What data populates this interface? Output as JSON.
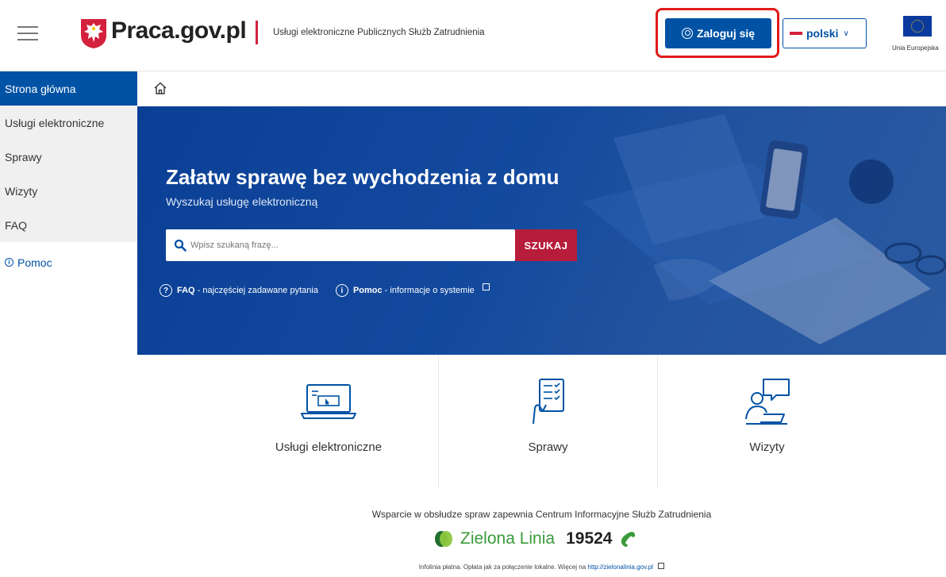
{
  "header": {
    "logo_text": "Praca.gov.pl",
    "tagline": "Usługi elektroniczne Publicznych Służb Zatrudnienia",
    "login_label": "Zaloguj się",
    "language_label": "polski",
    "eu_label": "Unia Europejska"
  },
  "sidebar": {
    "items": [
      {
        "label": "Strona główna",
        "active": true
      },
      {
        "label": "Usługi elektroniczne",
        "active": false
      },
      {
        "label": "Sprawy",
        "active": false
      },
      {
        "label": "Wizyty",
        "active": false
      },
      {
        "label": "FAQ",
        "active": false
      }
    ],
    "help_label": "Pomoc"
  },
  "hero": {
    "title": "Załatw sprawę bez wychodzenia z domu",
    "subtitle": "Wyszukaj usługę elektroniczną",
    "search_placeholder": "Wpisz szukaną frazę...",
    "search_button": "SZUKAJ",
    "faq_link_bold": "FAQ",
    "faq_link_text": " - najczęściej zadawane pytania",
    "help_link_bold": "Pomoc",
    "help_link_text": " - informacje o systemie"
  },
  "tiles": [
    {
      "label": "Usługi elektroniczne",
      "icon": "laptop-icon"
    },
    {
      "label": "Sprawy",
      "icon": "checklist-icon"
    },
    {
      "label": "Wizyty",
      "icon": "consultation-icon"
    }
  ],
  "footer": {
    "support_text": "Wsparcie w obsłudze spraw zapewnia Centrum Informacyjne Służb Zatrudnienia",
    "green_line_name": "Zielona Linia",
    "green_line_number": "19524",
    "note_text": "Infolinia płatna. Opłata jak za połączenie lokalne. Więcej na ",
    "note_link": "http://zielonalinia.gov.pl"
  },
  "colors": {
    "primary": "#0052a5",
    "accent_red": "#b71c3a",
    "hero_bg": "#134a9e",
    "green": "#3a9a3a",
    "highlight": "#e21b1b"
  }
}
